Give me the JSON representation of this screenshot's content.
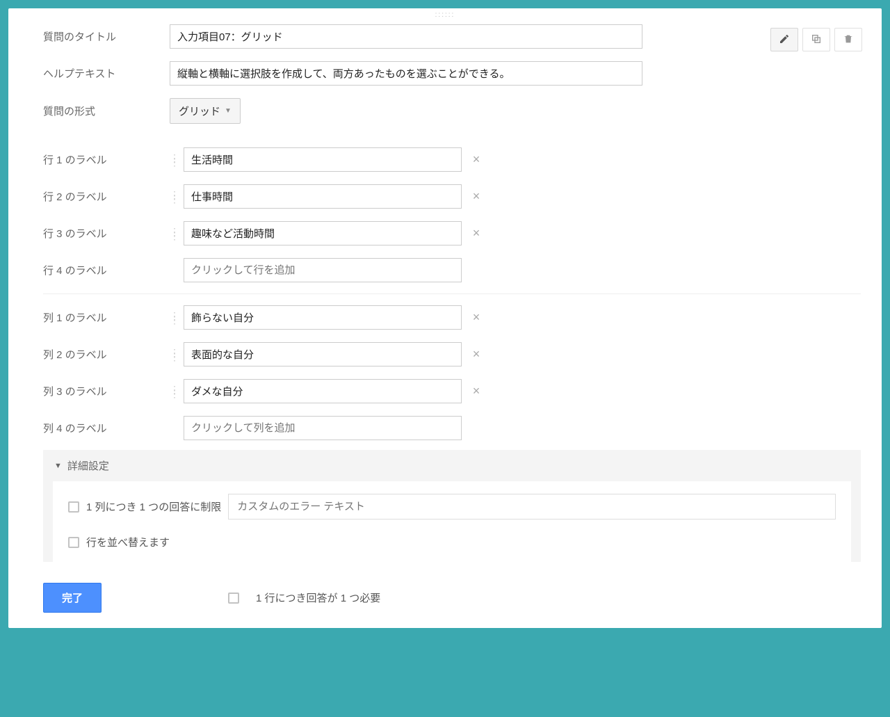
{
  "toolbar": {
    "edit_icon": "edit",
    "copy_icon": "copy",
    "delete_icon": "trash"
  },
  "labels": {
    "question_title": "質問のタイトル",
    "help_text": "ヘルプテキスト",
    "question_type": "質問の形式",
    "row1": "行 1 のラベル",
    "row2": "行 2 のラベル",
    "row3": "行 3 のラベル",
    "row4": "行 4 のラベル",
    "col1": "列 1 のラベル",
    "col2": "列 2 のラベル",
    "col3": "列 3 のラベル",
    "col4": "列 4 のラベル",
    "advanced": "詳細設定",
    "limit_one": "1 列につき 1 つの回答に制限",
    "shuffle": "行を並べ替えます",
    "require_one": "1 行につき回答が 1 つ必要",
    "done": "完了"
  },
  "values": {
    "title": "入力項目07：グリッド",
    "help": "縦軸と横軸に選択肢を作成して、両方あったものを選ぶことができる。",
    "type": "グリッド",
    "rows": [
      "生活時間",
      "仕事時間",
      "趣味など活動時間"
    ],
    "row_add_placeholder": "クリックして行を追加",
    "cols": [
      "飾らない自分",
      "表面的な自分",
      "ダメな自分"
    ],
    "col_add_placeholder": "クリックして列を追加",
    "error_placeholder": "カスタムのエラー テキスト"
  }
}
